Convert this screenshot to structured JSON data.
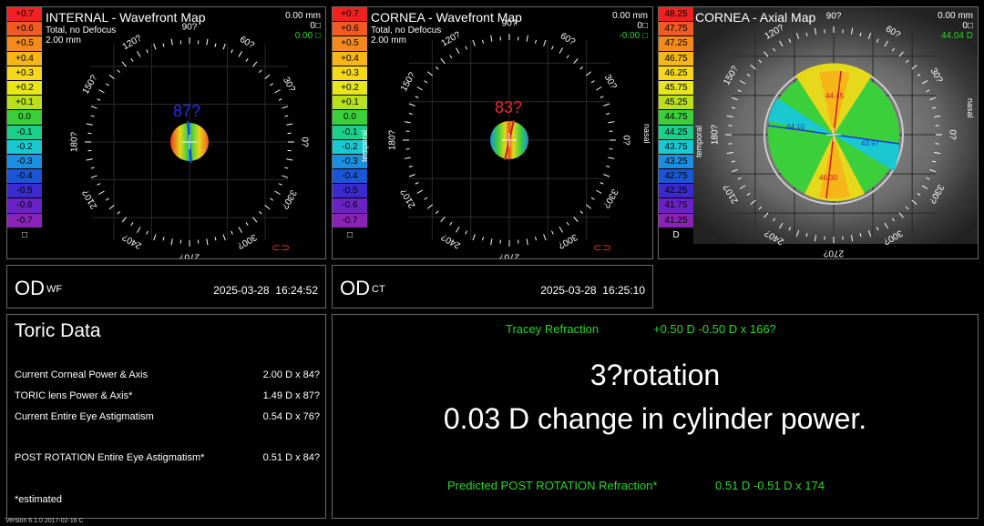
{
  "scale_wf": {
    "labels": [
      "+0.7",
      "+0.6",
      "+0.5",
      "+0.4",
      "+0.3",
      "+0.2",
      "+0.1",
      "0.0",
      "-0.1",
      "-0.2",
      "-0.3",
      "-0.4",
      "-0.5",
      "-0.6",
      "-0.7"
    ],
    "colors": [
      "#f22020",
      "#f25a20",
      "#f48a1a",
      "#f6b61a",
      "#f6d71a",
      "#e6e61a",
      "#b9e01a",
      "#3ccf3c",
      "#1ad08a",
      "#1ac8d2",
      "#1a8ee0",
      "#1a55d8",
      "#3a2ad0",
      "#6a22c8",
      "#8a22b8"
    ],
    "unit": "□"
  },
  "scale_axial": {
    "labels": [
      "48.25",
      "47.75",
      "47.25",
      "46.75",
      "46.25",
      "45.75",
      "45.25",
      "44.75",
      "44.25",
      "43.75",
      "43.25",
      "42.75",
      "42.25",
      "41.75",
      "41.25"
    ],
    "colors": [
      "#f22020",
      "#f25a20",
      "#f48a1a",
      "#f6b61a",
      "#f6d71a",
      "#e6e61a",
      "#b9e01a",
      "#3ccf3c",
      "#1ad08a",
      "#1ac8d2",
      "#1a8ee0",
      "#1a55d8",
      "#3a2ad0",
      "#6a22c8",
      "#8a22b8"
    ],
    "unit": "D"
  },
  "dial_labels": [
    "90?",
    "60?",
    "30?",
    "0?",
    "330?",
    "300?",
    "270?",
    "240?",
    "210?",
    "180?",
    "150?",
    "120?"
  ],
  "internal": {
    "title": "INTERNAL - Wavefront Map",
    "sub1": "Total, no Defocus",
    "sub2": "2.00 mm",
    "tr1": "0.00 mm",
    "tr2": "0□",
    "tr3": "0.00 □",
    "axis_label": "87?"
  },
  "cornea_wf": {
    "title": "CORNEA - Wavefront Map",
    "sub1": "Total, no Defocus",
    "sub2": "2.00 mm",
    "tr1": "0.00 mm",
    "tr2": "0□",
    "tr3": "-0.00 □",
    "axis_label": "83?",
    "temporal": "temporal",
    "nasal": "nasal"
  },
  "cornea_axial": {
    "title": "CORNEA - Axial Map",
    "tr1": "0.00 mm",
    "tr2": "0□",
    "tr3": "44.04 D",
    "temporal": "temporal",
    "nasal": "nasal",
    "k_labels": [
      "44.10",
      "43.97",
      "44.45",
      "46.30"
    ]
  },
  "od_wf": {
    "eye": "OD",
    "tag": "WF",
    "date": "2025-03-28",
    "time": "16:24:52"
  },
  "od_ct": {
    "eye": "OD",
    "tag": "CT",
    "date": "2025-03-28",
    "time": "16:25:10"
  },
  "toric": {
    "title": "Toric Data",
    "rows": [
      {
        "label": "Current Corneal Power & Axis",
        "value": "2.00 D x 84?"
      },
      {
        "label": "TORIC lens Power & Axis*",
        "value": "1.49 D x 87?"
      },
      {
        "label": "Current Entire Eye Astigmatism",
        "value": "0.54 D x 76?"
      },
      {
        "label": "POST ROTATION Entire Eye Astigmatism*",
        "value": "0.51 D x 84?"
      }
    ],
    "note": "*estimated"
  },
  "result": {
    "tracey_label": "Tracey Refraction",
    "tracey_value": "+0.50 D -0.50 D x 166?",
    "line1": "3?rotation",
    "line2": "0.03 D change in cylinder power.",
    "pred_label": "Predicted POST ROTATION Refraction*",
    "pred_value": "0.51 D  -0.51 D x 174"
  },
  "version": "Version 6.1.0 2017-02-16 C"
}
